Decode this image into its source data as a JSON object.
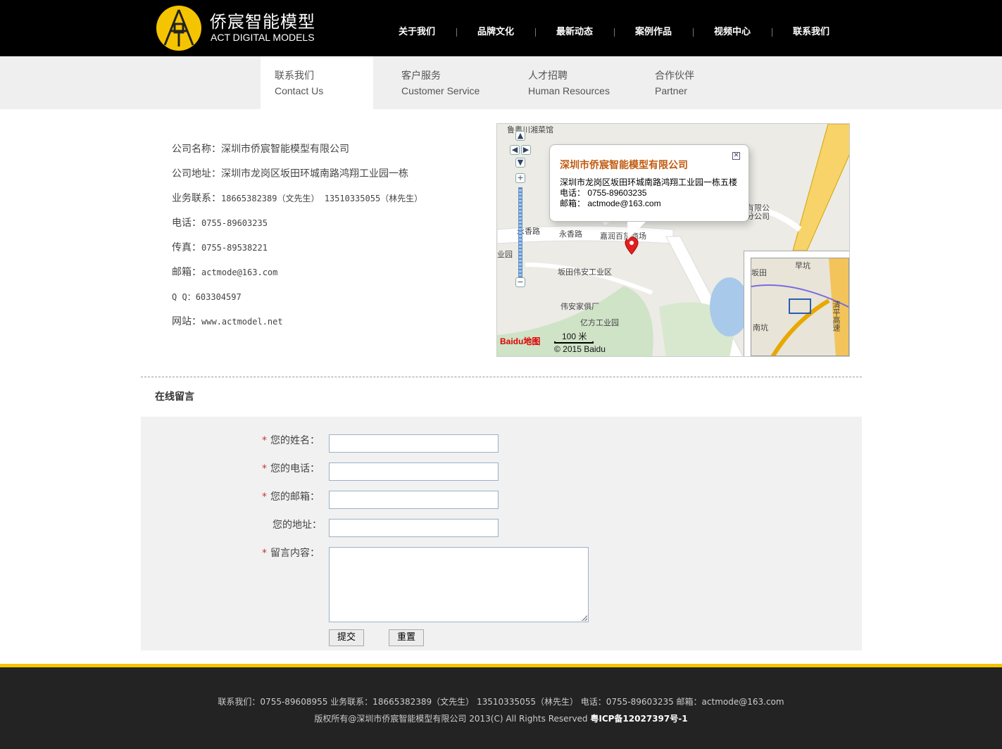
{
  "header": {
    "logo_cn": "侨宸智能模型",
    "logo_en": "ACT DIGITAL MODELS",
    "nav": [
      "关于我们",
      "品牌文化",
      "最新动态",
      "案例作品",
      "视频中心",
      "联系我们"
    ]
  },
  "subnav": [
    {
      "cn": "联系我们",
      "en": "Contact Us",
      "active": true
    },
    {
      "cn": "客户服务",
      "en": "Customer Service",
      "active": false
    },
    {
      "cn": "人才招聘",
      "en": "Human Resources",
      "active": false
    },
    {
      "cn": "合作伙伴",
      "en": "Partner",
      "active": false
    }
  ],
  "info": {
    "company": "公司名称：深圳市侨宸智能模型有限公司",
    "address": "公司地址：深圳市龙岗区坂田环城南路鸿翔工业园一栋",
    "business_label": "业务联系：",
    "business_value": "18665382389（文先生） 13510335055（林先生）",
    "phone_label": "电话：",
    "phone_value": "0755-89603235",
    "fax_label": "传真：",
    "fax_value": "0755-89538221",
    "email_label": "邮箱：",
    "email_value": "actmode@163.com",
    "qq_label": "Q Q：",
    "qq_value": "603304597",
    "site_label": "网站：",
    "site_value": "www.actmodel.net"
  },
  "map": {
    "popup_title": "深圳市侨宸智能模型有限公司",
    "popup_address": "深圳市龙岗区坂田环城南路鸿翔工业园一栋五楼",
    "popup_phone": "电话：   0755-89603235",
    "popup_email": "邮箱：   actmode@163.com",
    "close": "✕",
    "labels": {
      "restaurant": "鲁粤川湘菜馆",
      "road1": "永香路",
      "road2": "永香路",
      "mall": "嘉润百货商场",
      "park1": "坂田伟安工业区",
      "club": "伟安家俱厂",
      "park2": "亿方工业园",
      "company_frag": "有限公",
      "company_frag2": "分公司",
      "edge": "业园",
      "mini_1": "早坑",
      "mini_2": "南坑",
      "mini_3": "坂田",
      "mini_road": "清平高速"
    },
    "scale": "100 米",
    "logo": "Baidu地图",
    "copyright": "© 2015 Baidu"
  },
  "message": {
    "title": "在线留言",
    "required_mark": "*",
    "name_label": "您的姓名：",
    "phone_label": "您的电话：",
    "email_label": "您的邮箱：",
    "address_label": "您的地址：",
    "content_label": "留言内容：",
    "submit": "提交",
    "reset": "重置"
  },
  "footer": {
    "line1": "联系我们：0755-89608955 业务联系：18665382389（文先生） 13510335055（林先生） 电话：0755-89603235 邮箱：actmode@163.com",
    "line2_prefix": "版权所有@深圳市侨宸智能模型有限公司 2013(C) All Rights Reserved ",
    "line2_icp": "粤ICP备12027397号-1"
  },
  "colors": {
    "accent": "#f5c400",
    "header_bg": "#000000",
    "footer_bg": "#232323",
    "popup_title": "#c05a10"
  }
}
